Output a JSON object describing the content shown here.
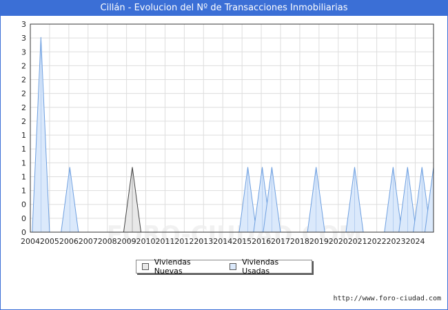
{
  "title": "Cillán - Evolucion del Nº de Transacciones Inmobiliarias",
  "footer_url": "http://www.foro-ciudad.com",
  "watermark": "FORO-CIUDAD.COM",
  "colors": {
    "title_bg": "#3b6fd6",
    "nuevas_fill": "#e8e8e8",
    "nuevas_line": "#444444",
    "usadas_fill": "#dbe9fb",
    "usadas_line": "#6fa0e0",
    "grid": "#dddddd"
  },
  "chart_data": {
    "type": "area",
    "title": "Cillán - Evolucion del Nº de Transacciones Inmobiliarias",
    "xlabel": "",
    "ylabel": "",
    "x_ticks": [
      "2004",
      "2005",
      "2006",
      "2007",
      "2008",
      "2009",
      "2010",
      "2011",
      "2012",
      "2013",
      "2014",
      "2015",
      "2016",
      "2017",
      "2018",
      "2019",
      "2020",
      "2021",
      "2022",
      "2023",
      "2024"
    ],
    "y_ticks": [
      "0",
      "0",
      "0",
      "1",
      "1",
      "1",
      "1",
      "1",
      "2",
      "2",
      "2",
      "2",
      "2",
      "3",
      "3",
      "3"
    ],
    "ylim": [
      0,
      3.2
    ],
    "xlim": [
      2004.0,
      2024.95
    ],
    "grid": true,
    "legend_position": "bottom",
    "series": [
      {
        "name": "Viviendas Nuevas",
        "peaks": [
          {
            "x": 2009.3,
            "value": 1
          }
        ]
      },
      {
        "name": "Viviendas Usadas",
        "peaks": [
          {
            "x": 2004.55,
            "value": 3
          },
          {
            "x": 2006.05,
            "value": 1
          },
          {
            "x": 2015.3,
            "value": 1
          },
          {
            "x": 2016.05,
            "value": 1
          },
          {
            "x": 2016.55,
            "value": 1
          },
          {
            "x": 2018.85,
            "value": 1
          },
          {
            "x": 2020.85,
            "value": 1
          },
          {
            "x": 2022.85,
            "value": 1
          },
          {
            "x": 2023.6,
            "value": 1
          },
          {
            "x": 2024.35,
            "value": 1
          },
          {
            "x": 2024.95,
            "value": 1
          }
        ]
      }
    ]
  }
}
